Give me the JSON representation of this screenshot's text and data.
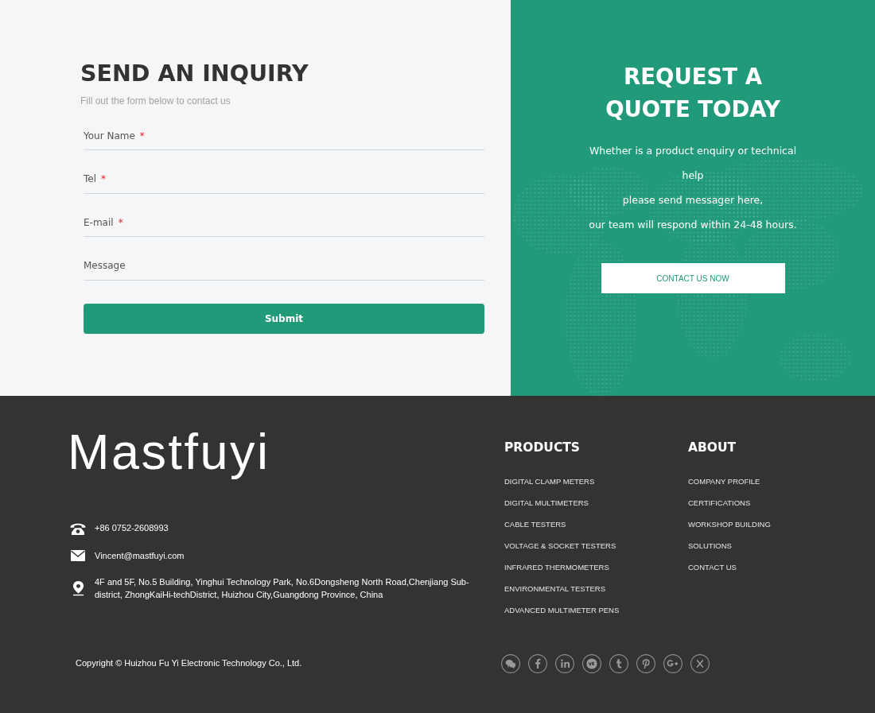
{
  "inquiry": {
    "title": "SEND AN INQUIRY",
    "subtitle": "Fill out the form below to contact us",
    "fields": [
      {
        "label": "Your Name",
        "required_mark": "*"
      },
      {
        "label": "Tel",
        "required_mark": "*"
      },
      {
        "label": "E-mail",
        "required_mark": "*"
      },
      {
        "label": "Message"
      }
    ],
    "submit": "Submit"
  },
  "quote": {
    "title": "REQUEST A QUOTE TODAY",
    "lines": [
      "Whether is a product enquiry or technical help",
      "please send messager here,",
      "our team will respond within 24-48 hours."
    ],
    "button": "CONTACT US NOW"
  },
  "footer": {
    "logo": "Mastfuyi",
    "contacts": [
      {
        "kind": "phone",
        "text": "+86 0752-2608993"
      },
      {
        "kind": "email",
        "text": "Vincent@mastfuyi.com"
      },
      {
        "kind": "address",
        "text": "4F and 5F, No.5 Building, Yinghui Technology Park, No.6Dongsheng North Road,Chenjiang Sub-district, ZhongKaiHi-techDistrict, Huizhou City,Guangdong Province, China"
      }
    ],
    "columns": [
      {
        "title": "PRODUCTS",
        "links": [
          "DIGITAL CLAMP METERS",
          "DIGITAL MULTIMETERS",
          "CABLE TESTERS",
          "VOLTAGE & SOCKET TESTERS",
          "INFRARED THERMOMETERS",
          "ENVIRONMENTAL TESTERS",
          "ADVANCED MULTIMETER PENS"
        ]
      },
      {
        "title": "ABOUT",
        "links": [
          "COMPANY PROFILE",
          "CERTIFICATIONS",
          "WORKSHOP BUILDING",
          "SOLUTIONS",
          "CONTACT US"
        ]
      }
    ],
    "copyright": "Copyright © Huizhou Fu Yi Electronic Technology Co., Ltd.",
    "social": [
      {
        "kind": "wechat"
      },
      {
        "kind": "facebook"
      },
      {
        "kind": "linkedin"
      },
      {
        "kind": "vk"
      },
      {
        "kind": "tumblr"
      },
      {
        "kind": "pinterest"
      },
      {
        "kind": "google-plus"
      },
      {
        "kind": "x"
      }
    ]
  }
}
